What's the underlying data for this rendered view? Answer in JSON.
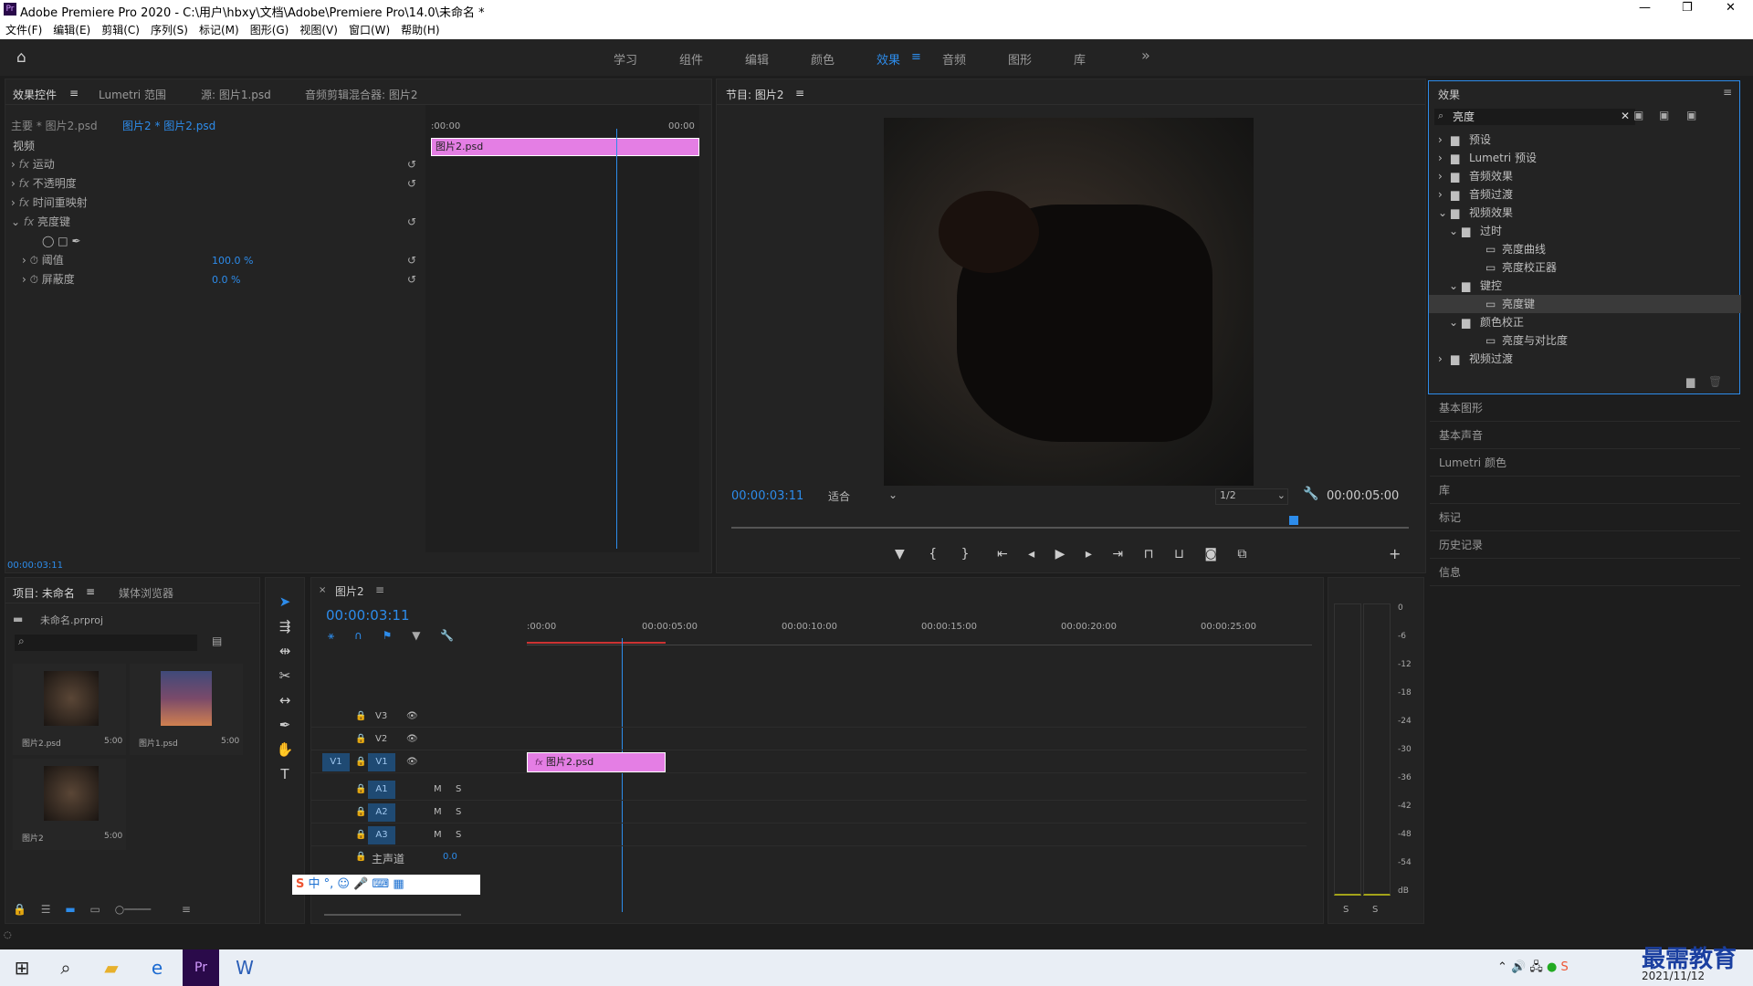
{
  "window": {
    "title": "Adobe Premiere Pro 2020 - C:\\用户\\hbxy\\文档\\Adobe\\Premiere Pro\\14.0\\未命名 *",
    "min": "—",
    "max": "❐",
    "close": "✕"
  },
  "menu": [
    "文件(F)",
    "编辑(E)",
    "剪辑(C)",
    "序列(S)",
    "标记(M)",
    "图形(G)",
    "视图(V)",
    "窗口(W)",
    "帮助(H)"
  ],
  "workspaces": [
    "学习",
    "组件",
    "编辑",
    "颜色",
    "效果",
    "音频",
    "图形",
    "库"
  ],
  "workspace_more": "»",
  "effect_controls": {
    "tabs": [
      "效果控件",
      "Lumetri 范围",
      "源: 图片1.psd",
      "音频剪辑混合器: 图片2"
    ],
    "master": "主要 * 图片2.psd",
    "clip": "图片2 * 图片2.psd",
    "time_start": ":00:00",
    "time_end": "00:00",
    "clip_label": "图片2.psd",
    "section": "视频",
    "effects": [
      "运动",
      "不透明度",
      "时间重映射",
      "亮度键"
    ],
    "params": [
      {
        "name": "阈值",
        "value": "100.0 %"
      },
      {
        "name": "屏蔽度",
        "value": "0.0 %"
      }
    ],
    "timecode": "00:00:03:11"
  },
  "program": {
    "title": "节目: 图片2",
    "timecode": "00:00:03:11",
    "fit": "适合",
    "res": "1/2",
    "duration": "00:00:05:00",
    "playhead": 0.83
  },
  "effects_panel": {
    "title": "效果",
    "search": "亮度",
    "tree": [
      {
        "label": "预设",
        "level": 0,
        "kind": "folder"
      },
      {
        "label": "Lumetri 预设",
        "level": 0,
        "kind": "folder"
      },
      {
        "label": "音频效果",
        "level": 0,
        "kind": "folder"
      },
      {
        "label": "音频过渡",
        "level": 0,
        "kind": "folder"
      },
      {
        "label": "视频效果",
        "level": 0,
        "kind": "folder-open"
      },
      {
        "label": "过时",
        "level": 1,
        "kind": "folder-open"
      },
      {
        "label": "亮度曲线",
        "level": 2,
        "kind": "fx"
      },
      {
        "label": "亮度校正器",
        "level": 2,
        "kind": "fx"
      },
      {
        "label": "键控",
        "level": 1,
        "kind": "folder-open"
      },
      {
        "label": "亮度键",
        "level": 2,
        "kind": "fx",
        "selected": true
      },
      {
        "label": "颜色校正",
        "level": 1,
        "kind": "folder-open"
      },
      {
        "label": "亮度与对比度",
        "level": 2,
        "kind": "fx"
      },
      {
        "label": "视频过渡",
        "level": 0,
        "kind": "folder"
      }
    ]
  },
  "side_panels": [
    "基本图形",
    "基本声音",
    "Lumetri 颜色",
    "库",
    "标记",
    "历史记录",
    "信息"
  ],
  "project": {
    "tabs": [
      "项目: 未命名",
      "媒体浏览器"
    ],
    "file": "未命名.prproj",
    "items": [
      {
        "name": "图片2.psd",
        "dur": "5:00"
      },
      {
        "name": "图片1.psd",
        "dur": "5:00"
      },
      {
        "name": "图片2",
        "dur": "5:00"
      }
    ]
  },
  "timeline": {
    "tab": "图片2",
    "timecode": "00:00:03:11",
    "ruler": [
      ":00:00",
      "00:00:05:00",
      "00:00:10:00",
      "00:00:15:00",
      "00:00:20:00",
      "00:00:25:00"
    ],
    "video_tracks": [
      "V3",
      "V2",
      "V1"
    ],
    "audio_tracks": [
      "A1",
      "A2",
      "A3"
    ],
    "source_v": "V1",
    "master": "主声道",
    "master_val": "0.0",
    "clip": "图片2.psd",
    "m": "M",
    "s": "S"
  },
  "meter": {
    "scale": [
      "0",
      "-6",
      "-12",
      "-18",
      "-24",
      "-30",
      "-36",
      "-42",
      "-48",
      "-54",
      "dB"
    ],
    "solo": [
      "S",
      "S"
    ]
  },
  "ime": {
    "label": "中 °,"
  },
  "taskbar": {
    "date": "2021/11/12",
    "watermark": "最需教育"
  }
}
